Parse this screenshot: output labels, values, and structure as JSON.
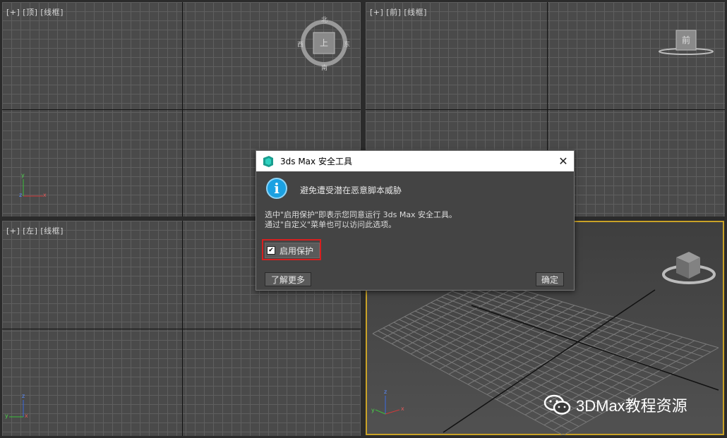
{
  "viewports": {
    "top": {
      "label": "[+] [顶] [线框]",
      "cube_face": "上",
      "compass": {
        "n": "北",
        "s": "南",
        "e": "东",
        "w": "西"
      }
    },
    "front": {
      "label": "[+] [前] [线框]",
      "cube_face": "前"
    },
    "left": {
      "label": "[+] [左] [线框]"
    },
    "persp": {
      "label": ""
    }
  },
  "axes": {
    "x": "x",
    "y": "y",
    "z": "z"
  },
  "dialog": {
    "title": "3ds Max 安全工具",
    "headline": "避免遭受潜在恶意脚本威胁",
    "desc_line1": "选中\"启用保护\"即表示您同意运行 3ds Max 安全工具。",
    "desc_line2": "通过\"自定义\"菜单也可以访问此选项。",
    "enable_protection_label": "启用保护",
    "enable_protection_checked": true,
    "learn_more_label": "了解更多",
    "ok_label": "确定",
    "close_glyph": "✕",
    "info_glyph": "i"
  },
  "watermark": {
    "text": "3DMax教程资源",
    "icon": "wechat-icon"
  },
  "colors": {
    "accent_active_viewport": "#c9a227",
    "highlight_box": "#d62020",
    "info": "#1ba1e2"
  }
}
